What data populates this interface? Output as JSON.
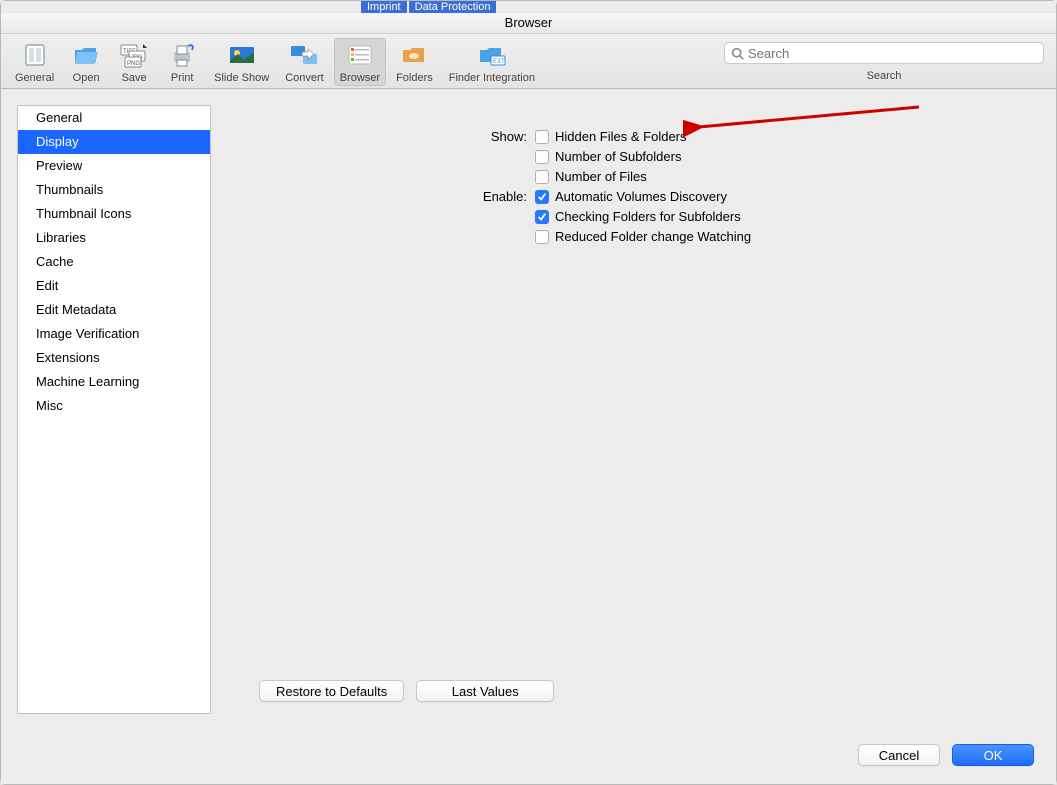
{
  "background_tabs": [
    "Imprint",
    "Data Protection"
  ],
  "window_title": "Browser",
  "toolbar": {
    "items": [
      {
        "id": "general",
        "label": "General",
        "icon": "prefs-icon",
        "selected": false
      },
      {
        "id": "open",
        "label": "Open",
        "icon": "folder-open-icon",
        "selected": false
      },
      {
        "id": "save",
        "label": "Save",
        "icon": "file-types-icon",
        "selected": false
      },
      {
        "id": "print",
        "label": "Print",
        "icon": "printer-icon",
        "selected": false
      },
      {
        "id": "slideshow",
        "label": "Slide Show",
        "icon": "slideshow-icon",
        "selected": false
      },
      {
        "id": "convert",
        "label": "Convert",
        "icon": "convert-icon",
        "selected": false
      },
      {
        "id": "browser",
        "label": "Browser",
        "icon": "list-icon",
        "selected": true
      },
      {
        "id": "folders",
        "label": "Folders",
        "icon": "folder-icon",
        "selected": false
      },
      {
        "id": "finder",
        "label": "Finder Integration",
        "icon": "finder-ext-icon",
        "selected": false
      }
    ],
    "search_placeholder": "Search",
    "search_label": "Search"
  },
  "sidebar": {
    "items": [
      "General",
      "Display",
      "Preview",
      "Thumbnails",
      "Thumbnail Icons",
      "Libraries",
      "Cache",
      "Edit",
      "Edit Metadata",
      "Image Verification",
      "Extensions",
      "Machine Learning",
      "Misc"
    ],
    "selected_index": 1
  },
  "settings": {
    "groups": [
      {
        "label": "Show:",
        "options": [
          {
            "label": "Hidden Files & Folders",
            "checked": false
          },
          {
            "label": "Number of Subfolders",
            "checked": false
          },
          {
            "label": "Number of Files",
            "checked": false
          }
        ]
      },
      {
        "label": "Enable:",
        "options": [
          {
            "label": "Automatic Volumes Discovery",
            "checked": true
          },
          {
            "label": "Checking Folders for Subfolders",
            "checked": true
          },
          {
            "label": "Reduced Folder change Watching",
            "checked": false
          }
        ]
      }
    ],
    "restore_btn": "Restore to Defaults",
    "last_values_btn": "Last Values"
  },
  "footer": {
    "cancel": "Cancel",
    "ok": "OK"
  },
  "annotation": {
    "type": "arrow",
    "color": "#d00000"
  }
}
